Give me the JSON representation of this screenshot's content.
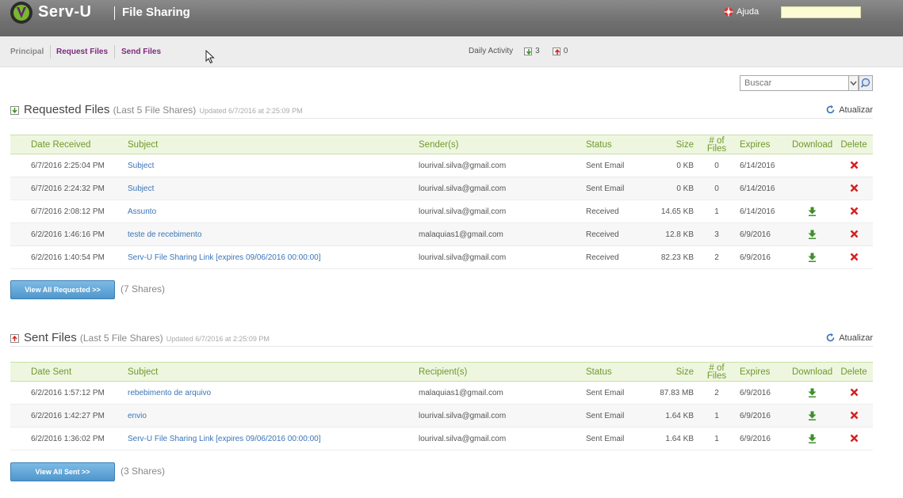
{
  "header": {
    "brand": "Serv-U",
    "title": "File Sharing",
    "help_label": "Ajuda",
    "user_box_value": ""
  },
  "nav": {
    "principal": "Principal",
    "request_files": "Request Files",
    "send_files": "Send Files",
    "daily_activity_label": "Daily Activity",
    "download_count": "3",
    "upload_count": "0"
  },
  "search": {
    "placeholder": "Buscar"
  },
  "requested": {
    "title": "Requested Files",
    "subtitle": "(Last 5 File Shares)",
    "updated": "Updated 6/7/2016 at 2:25:09 PM",
    "refresh_label": "Atualizar",
    "columns": [
      "Date Received",
      "Subject",
      "Sender(s)",
      "Status",
      "Size",
      "# of Files",
      "Expires",
      "Download",
      "Delete"
    ],
    "rows": [
      {
        "date": "6/7/2016 2:25:04 PM",
        "subject": "Subject",
        "sender": "lourival.silva@gmail.com",
        "status": "Sent Email",
        "size": "0 KB",
        "files": "0",
        "expires": "6/14/2016",
        "download": false
      },
      {
        "date": "6/7/2016 2:24:32 PM",
        "subject": "Subject",
        "sender": "lourival.silva@gmail.com",
        "status": "Sent Email",
        "size": "0 KB",
        "files": "0",
        "expires": "6/14/2016",
        "download": false
      },
      {
        "date": "6/7/2016 2:08:12 PM",
        "subject": "Assunto",
        "sender": "lourival.silva@gmail.com",
        "status": "Received",
        "size": "14.65 KB",
        "files": "1",
        "expires": "6/14/2016",
        "download": true
      },
      {
        "date": "6/2/2016 1:46:16 PM",
        "subject": "teste de recebimento",
        "sender": "malaquias1@gmail.com",
        "status": "Received",
        "size": "12.8 KB",
        "files": "3",
        "expires": "6/9/2016",
        "download": true
      },
      {
        "date": "6/2/2016 1:40:54 PM",
        "subject": "Serv-U File Sharing Link [expires 09/06/2016 00:00:00]",
        "sender": "lourival.silva@gmail.com",
        "status": "Received",
        "size": "82.23 KB",
        "files": "2",
        "expires": "6/9/2016",
        "download": true
      }
    ],
    "view_all_label": "View All Requested >>",
    "shares_count": "(7 Shares)"
  },
  "sent": {
    "title": "Sent Files",
    "subtitle": "(Last 5 File Shares)",
    "updated": "Updated 6/7/2016 at 2:25:09 PM",
    "refresh_label": "Atualizar",
    "columns": [
      "Date Sent",
      "Subject",
      "Recipient(s)",
      "Status",
      "Size",
      "# of Files",
      "Expires",
      "Download",
      "Delete"
    ],
    "rows": [
      {
        "date": "6/2/2016 1:57:12 PM",
        "subject": "rebebimento de arquivo",
        "sender": "malaquias1@gmail.com",
        "status": "Sent Email",
        "size": "87.83 MB",
        "files": "2",
        "expires": "6/9/2016",
        "download": true
      },
      {
        "date": "6/2/2016 1:42:27 PM",
        "subject": "envio",
        "sender": "lourival.silva@gmail.com",
        "status": "Sent Email",
        "size": "1.64 KB",
        "files": "1",
        "expires": "6/9/2016",
        "download": true
      },
      {
        "date": "6/2/2016 1:36:02 PM",
        "subject": "Serv-U File Sharing Link [expires 09/06/2016 00:00:00]",
        "sender": "lourival.silva@gmail.com",
        "status": "Sent Email",
        "size": "1.64 KB",
        "files": "1",
        "expires": "6/9/2016",
        "download": true
      }
    ],
    "view_all_label": "View All Sent >>",
    "shares_count": "(3 Shares)"
  },
  "colors": {
    "header_bg": "#6f6f6f",
    "nav_link": "#7d2a7d",
    "table_header_bg": "#eef6df",
    "table_header_text": "#6f9a2e",
    "link": "#3a74b8",
    "download_icon": "#3f8f2b",
    "delete_icon": "#d42020",
    "button_bg": "#5b9fd3"
  },
  "icons": {
    "logo": "serv-u-logo",
    "help": "lifebuoy-icon",
    "download": "download-arrow-icon",
    "delete": "red-x-icon",
    "refresh": "refresh-icon",
    "search": "magnifier-icon"
  }
}
